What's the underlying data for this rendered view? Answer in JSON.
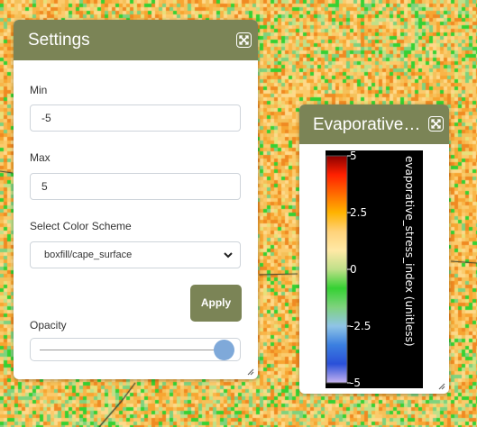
{
  "settings_panel": {
    "title": "Settings",
    "min": {
      "label": "Min",
      "value": "-5"
    },
    "max": {
      "label": "Max",
      "value": "5"
    },
    "color_scheme": {
      "label": "Select Color Scheme",
      "selected": "boxfill/cape_surface"
    },
    "apply_label": "Apply",
    "opacity": {
      "label": "Opacity",
      "value_fraction": 0.95
    },
    "icons": {
      "close": "close-icon",
      "resize": "resize-grip-icon",
      "chevron": "chevron-down-icon"
    }
  },
  "legend_panel": {
    "title": "Evaporative Stress Index",
    "colorbar": {
      "variable_label": "evaporative_stress_index (unitless)",
      "ticks": [
        "5",
        "2.5",
        "0",
        "-2.5",
        "-5"
      ],
      "colors_top_to_bottom": [
        "#8b0000",
        "#ff2000",
        "#ff6a00",
        "#ffb300",
        "#ffd27a",
        "#ffe9a6",
        "#bfe089",
        "#35d133",
        "#7fd27e",
        "#8fc4e6",
        "#3b7fe0",
        "#2a50d8",
        "#c7b3f0"
      ]
    }
  },
  "colors": {
    "panel_header": "#7b8456",
    "apply_button": "#7b8456",
    "slider_thumb": "#7fa9d9"
  }
}
